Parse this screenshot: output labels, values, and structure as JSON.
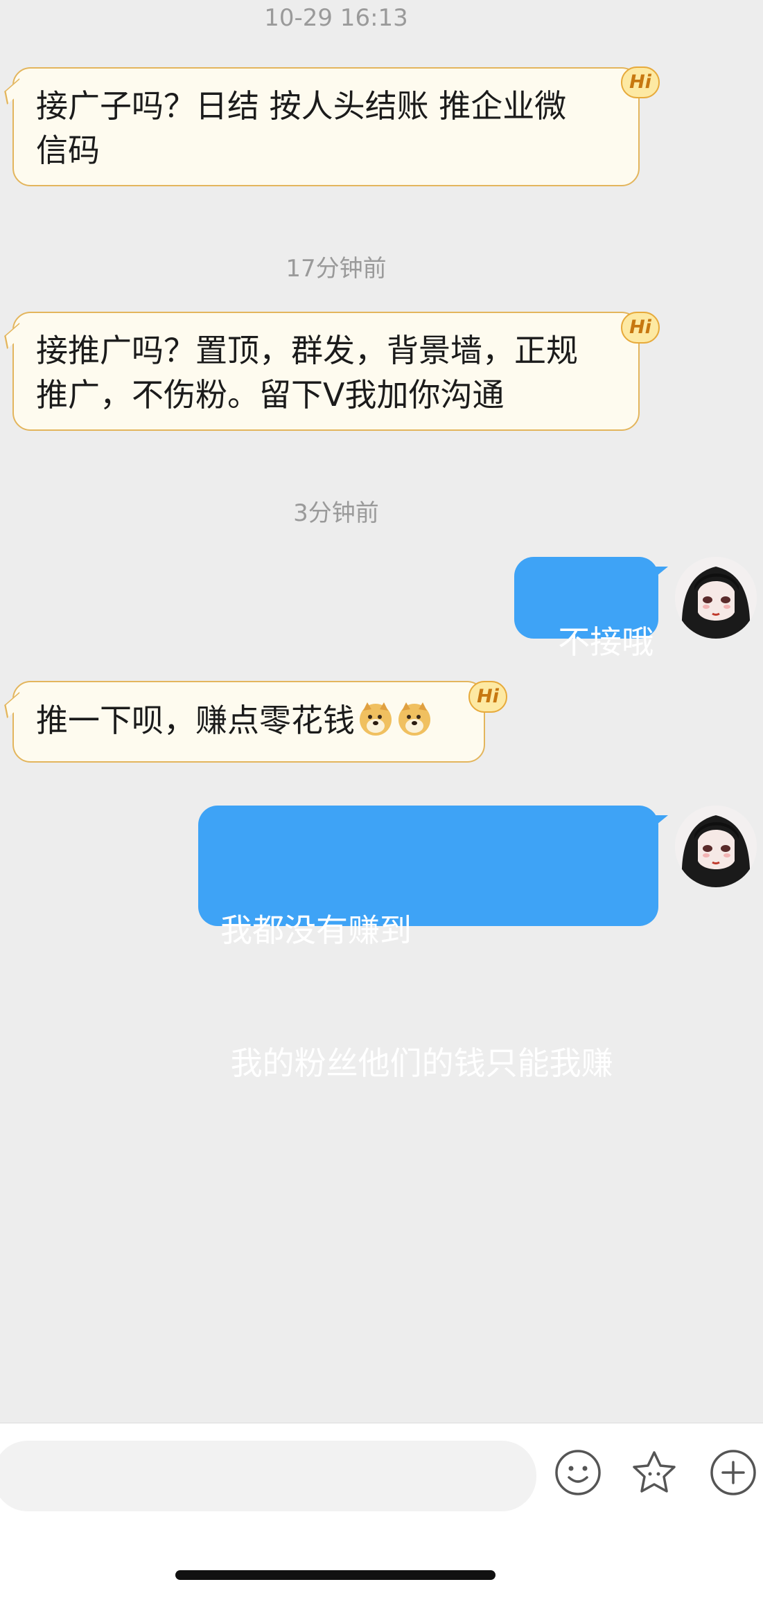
{
  "timestamps": [
    "10-29 16:13",
    "17分钟前",
    "3分钟前"
  ],
  "messages": {
    "m1": {
      "line1": "接广子吗？日结 按人头结账 推企业微",
      "line2": "信码",
      "badge": "Hi"
    },
    "m2": {
      "line1": "接推广吗？置顶，群发，背景墙，正规",
      "line2": "推广，不伤粉。留下Ⅴ我加你沟通",
      "badge": "Hi"
    },
    "m3": {
      "text": "不接哦"
    },
    "m4": {
      "text": "推一下呗，赚点零花钱",
      "badge": "Hi",
      "emoji": "doge"
    },
    "m5": {
      "line1": "我都没有赚到",
      "line2": " 我的粉丝他们的钱只能我赚"
    }
  },
  "bottom_bar": {
    "input_placeholder": "",
    "icons": [
      "emoji-face-icon",
      "star-icon",
      "plus-icon"
    ]
  },
  "colors": {
    "incoming_bubble": "#fefbef",
    "incoming_border": "#e3b55c",
    "outgoing_bubble": "#3ea3f6",
    "background": "#ededed"
  }
}
